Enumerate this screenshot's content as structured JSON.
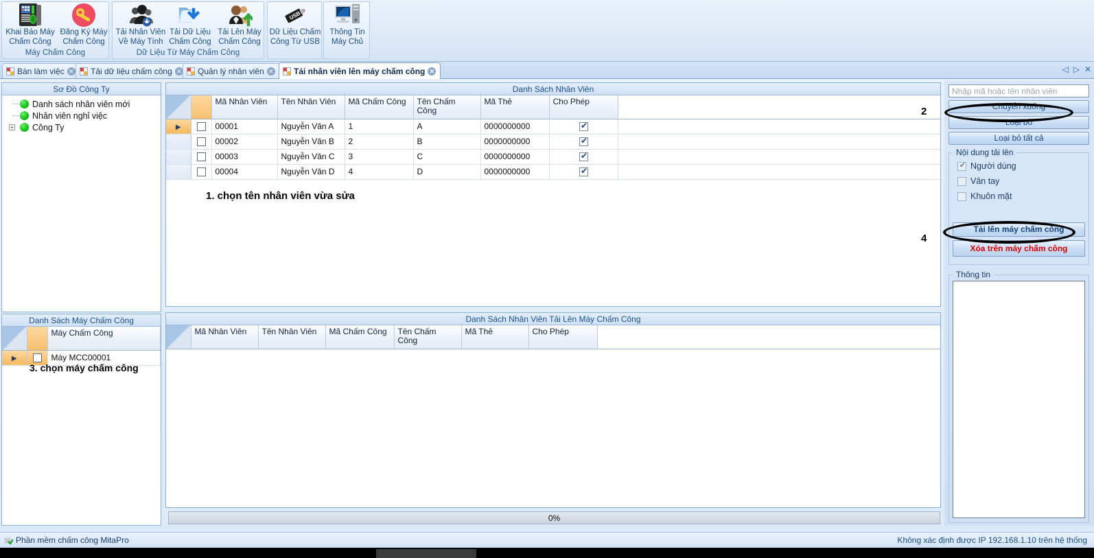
{
  "ribbon": {
    "groups": [
      {
        "title": "Máy Chấm Công",
        "buttons": [
          {
            "label_line1": "Khai Báo Máy",
            "label_line2": "Chấm Công",
            "icon": "attendance-terminal-icon"
          },
          {
            "label_line1": "Đăng Ký Máy",
            "label_line2": "Chấm Công",
            "icon": "red-key-icon"
          }
        ]
      },
      {
        "title": "Dữ Liệu Từ Máy Chấm Công",
        "buttons": [
          {
            "label_line1": "Tải Nhân Viên",
            "label_line2": "Về Máy Tính",
            "icon": "users-download-icon"
          },
          {
            "label_line1": "Tải Dữ Liệu",
            "label_line2": "Chấm Công",
            "icon": "folder-download-icon"
          },
          {
            "label_line1": "Tải Lên Máy",
            "label_line2": "Chấm Công",
            "icon": "users-upload-icon"
          }
        ]
      },
      {
        "title": "",
        "buttons": [
          {
            "label_line1": "Dữ Liệu Chấm",
            "label_line2": "Công Từ USB",
            "icon": "usb-drive-icon"
          }
        ]
      },
      {
        "title": "",
        "buttons": [
          {
            "label_line1": "Thông Tin",
            "label_line2": "Máy Chủ",
            "icon": "server-computer-icon"
          }
        ]
      }
    ]
  },
  "tabs": {
    "items": [
      {
        "label": "Bàn làm việc",
        "active": false
      },
      {
        "label": "Tải dữ liệu chấm công",
        "active": false
      },
      {
        "label": "Quản lý nhân viên",
        "active": false
      },
      {
        "label": "Tải nhân viên lên máy chấm công",
        "active": true
      }
    ],
    "nav": {
      "prev": "◁",
      "next": "▷",
      "close": "✕"
    }
  },
  "company_tree": {
    "title": "Sơ Đồ Công Ty",
    "nodes": [
      {
        "label": "Danh sách nhân viên mới",
        "expandable": false
      },
      {
        "label": "Nhân viên nghỉ việc",
        "expandable": false
      },
      {
        "label": "Công Ty",
        "expandable": true,
        "expander": "+"
      }
    ]
  },
  "device_list": {
    "title": "Danh Sách Máy Chấm Công",
    "column_header": "Máy Chấm Công",
    "rows": [
      {
        "name": "Máy MCC00001",
        "checked": false,
        "current": true
      }
    ],
    "annotation": "3. chọn máy chấm công"
  },
  "employee_grid": {
    "title": "Danh Sách Nhân Viên",
    "columns": [
      "Mã Nhân Viên",
      "Tên Nhân Viên",
      "Mã Chấm Công",
      "Tên Chấm Công",
      "Mã Thẻ",
      "Cho Phép"
    ],
    "rows": [
      {
        "ma_nhan_vien": "00001",
        "ten_nhan_vien": "Nguyễn Văn A",
        "ma_cham_cong": "1",
        "ten_cham_cong": "A",
        "ma_the": "0000000000",
        "cho_phep": true,
        "selected": false,
        "current": true
      },
      {
        "ma_nhan_vien": "00002",
        "ten_nhan_vien": "Nguyễn Văn B",
        "ma_cham_cong": "2",
        "ten_cham_cong": "B",
        "ma_the": "0000000000",
        "cho_phep": true,
        "selected": false,
        "current": false
      },
      {
        "ma_nhan_vien": "00003",
        "ten_nhan_vien": "Nguyễn Văn C",
        "ma_cham_cong": "3",
        "ten_cham_cong": "C",
        "ma_the": "0000000000",
        "cho_phep": true,
        "selected": false,
        "current": false
      },
      {
        "ma_nhan_vien": "00004",
        "ten_nhan_vien": "Nguyễn Văn D",
        "ma_cham_cong": "4",
        "ten_cham_cong": "D",
        "ma_the": "0000000000",
        "cho_phep": true,
        "selected": false,
        "current": false
      }
    ],
    "annotation": "1. chọn tên nhân viên vừa sửa",
    "step_marker_2": "2",
    "step_marker_4": "4"
  },
  "upload_grid": {
    "title": "Danh Sách Nhân Viên Tải Lên Máy Chấm Công",
    "columns": [
      "Mã Nhân Viên",
      "Tên Nhân Viên",
      "Mã Chấm Công",
      "Tên Chấm Công",
      "Mã Thẻ",
      "Cho Phép"
    ],
    "rows": []
  },
  "sidebar": {
    "search_placeholder": "Nhập mã hoặc tên nhân viên",
    "search_value": "",
    "buttons": {
      "move_down": "Chuyển xuống",
      "remove": "Loại bỏ",
      "remove_all": "Loại bỏ tất cả",
      "upload": "Tải lên máy chấm công",
      "delete_on_device": "Xóa trên máy chấm công"
    },
    "upload_content": {
      "legend": "Nội dung tải lên",
      "options": [
        {
          "label": "Người dùng",
          "checked": true
        },
        {
          "label": "Vân tay",
          "checked": false
        },
        {
          "label": "Khuôn mặt",
          "checked": false
        }
      ]
    },
    "info": {
      "legend": "Thông tin",
      "text": ""
    }
  },
  "progress": {
    "text": "0%",
    "value": 0
  },
  "statusbar": {
    "left": "Phần mềm chấm công MitaPro",
    "right": "Không xác định được IP 192.168.1.10 trên hệ thống"
  },
  "colors": {
    "accent": "#1d4f8c",
    "panel_border": "#8ab0d8",
    "danger": "#e00000",
    "tree_node": "#18c418",
    "header_orange": "#f7bf6e"
  }
}
